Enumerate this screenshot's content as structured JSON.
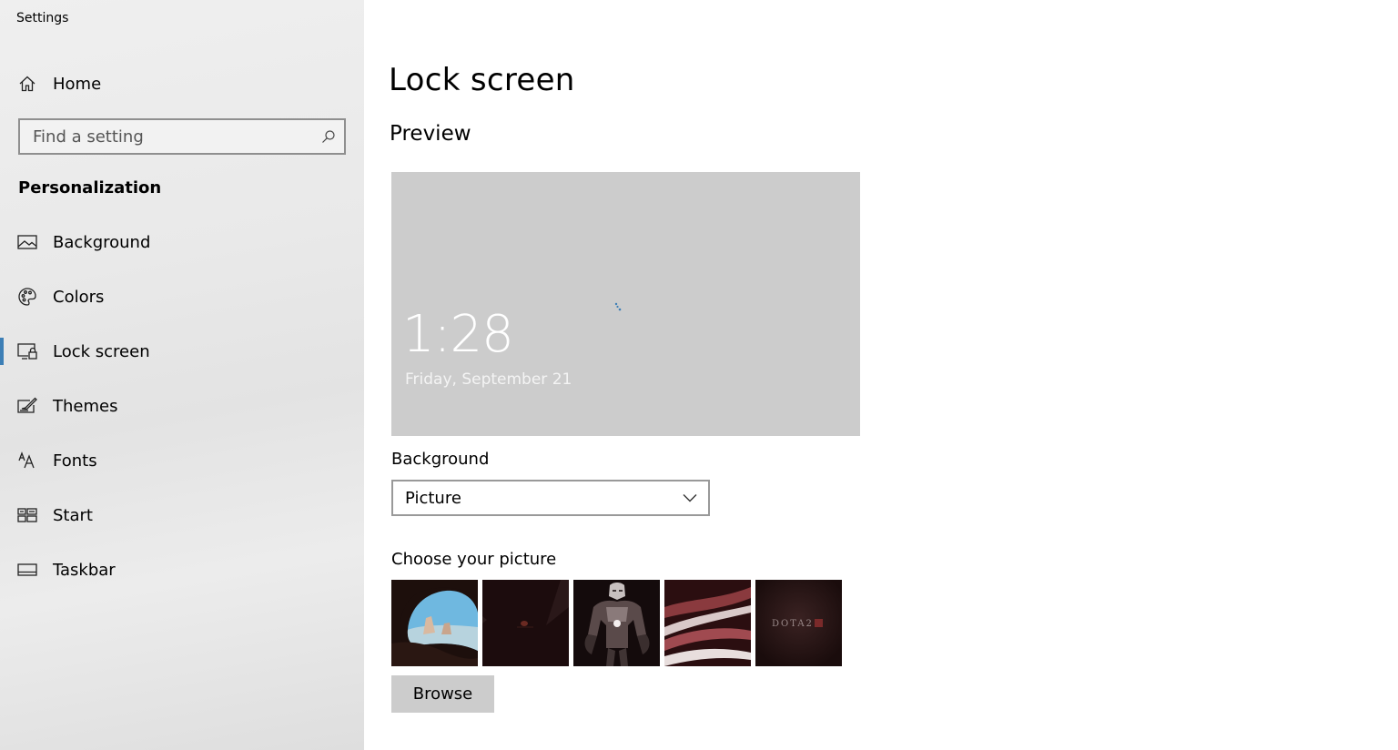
{
  "app": {
    "title": "Settings"
  },
  "sidebar": {
    "home_label": "Home",
    "search_placeholder": "Find a setting",
    "section_title": "Personalization",
    "items": [
      {
        "label": "Background",
        "icon": "picture-icon"
      },
      {
        "label": "Colors",
        "icon": "palette-icon"
      },
      {
        "label": "Lock screen",
        "icon": "lock-screen-icon",
        "active": true
      },
      {
        "label": "Themes",
        "icon": "themes-icon"
      },
      {
        "label": "Fonts",
        "icon": "fonts-icon"
      },
      {
        "label": "Start",
        "icon": "start-icon"
      },
      {
        "label": "Taskbar",
        "icon": "taskbar-icon"
      }
    ]
  },
  "main": {
    "page_title": "Lock screen",
    "preview_title": "Preview",
    "preview": {
      "time": "1:28",
      "date": "Friday, September 21"
    },
    "background_label": "Background",
    "background_value": "Picture",
    "choose_label": "Choose your picture",
    "thumbnails": [
      {
        "name": "beach-cave-thumbnail"
      },
      {
        "name": "dark-scene-thumbnail"
      },
      {
        "name": "iron-man-thumbnail"
      },
      {
        "name": "abstract-waves-thumbnail"
      },
      {
        "name": "dota2-thumbnail",
        "text": "DOTA2"
      }
    ],
    "browse_label": "Browse"
  },
  "colors": {
    "accent": "#3d7fb6",
    "preview_bg": "#cccccc",
    "button_bg": "#cccccc"
  }
}
